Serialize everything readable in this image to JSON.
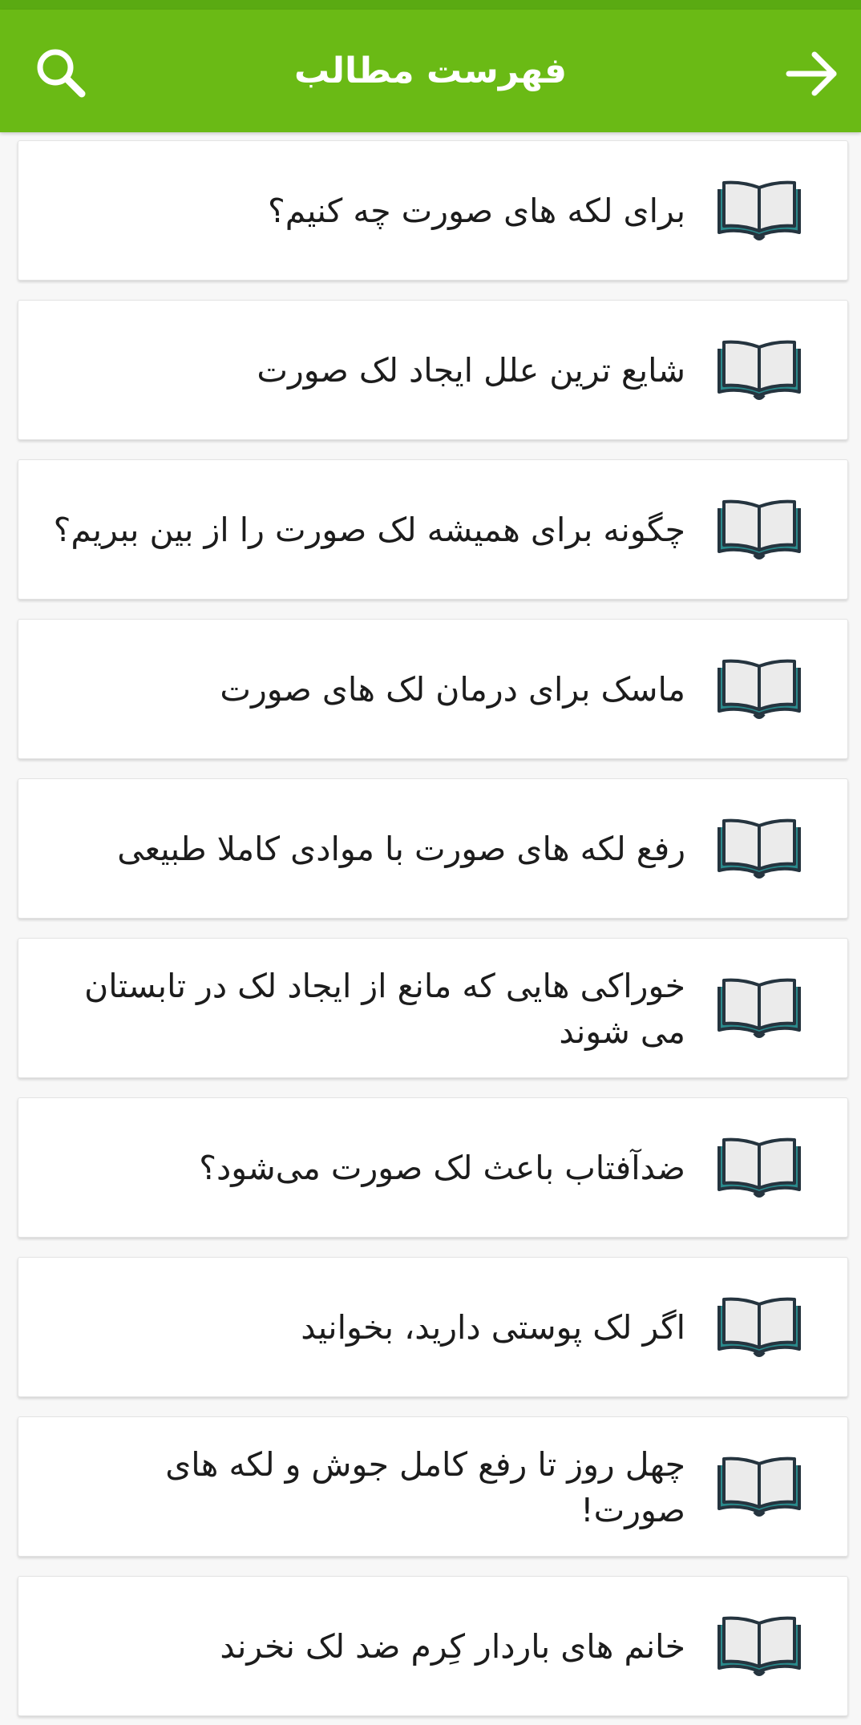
{
  "appbar": {
    "title": "فهرست مطالب",
    "search_icon": "search-icon",
    "back_icon": "arrow-right-icon",
    "color": "#6aba15"
  },
  "items": [
    {
      "label": "برای لکه های صورت چه کنیم؟",
      "icon": "open-book-icon"
    },
    {
      "label": "شایع ترین علل ایجاد لک صورت",
      "icon": "open-book-icon"
    },
    {
      "label": "چگونه برای همیشه لک صورت را از بین ببریم؟",
      "icon": "open-book-icon"
    },
    {
      "label": "ماسک برای درمان لک های صورت",
      "icon": "open-book-icon"
    },
    {
      "label": "رفع لکه های صورت با موادی کاملا طبیعی",
      "icon": "open-book-icon"
    },
    {
      "label": "خوراکی هایی که مانع از ایجاد لک در تابستان می شوند",
      "icon": "open-book-icon"
    },
    {
      "label": "ضدآفتاب باعث لک صورت می‌شود؟",
      "icon": "open-book-icon"
    },
    {
      "label": "اگر لک پوستی دارید، بخوانید",
      "icon": "open-book-icon"
    },
    {
      "label": "چهل روز تا رفع کامل جوش و لکه های صورت!",
      "icon": "open-book-icon"
    },
    {
      "label": "خانم های باردار کِرم ضد لک نخرند",
      "icon": "open-book-icon"
    }
  ]
}
